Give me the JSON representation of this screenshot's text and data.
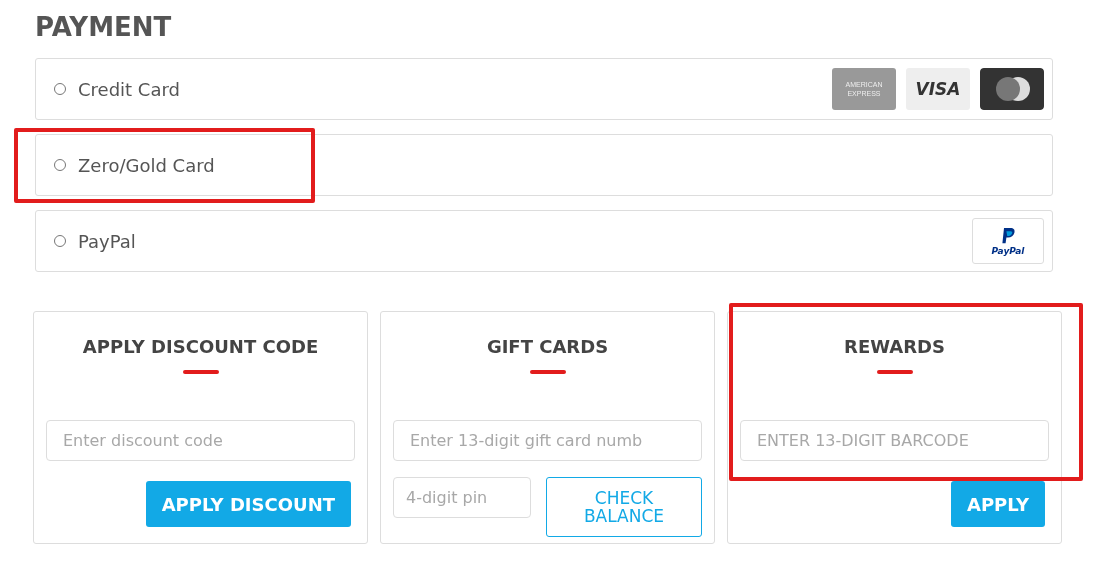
{
  "title": "PAYMENT",
  "payment_options": [
    {
      "label": "Credit Card",
      "selected": false,
      "highlighted": false,
      "logos": [
        {
          "kind": "amex",
          "text": [
            "AMERICAN",
            "EXPRESS"
          ]
        },
        {
          "kind": "visa",
          "text": [
            "VISA"
          ]
        },
        {
          "kind": "mastercard"
        }
      ]
    },
    {
      "label": "Zero/Gold Card",
      "selected": false,
      "highlighted": true
    },
    {
      "label": "PayPal",
      "selected": false,
      "highlighted": false,
      "logos": [
        {
          "kind": "paypal",
          "text": [
            "PayPal"
          ]
        }
      ]
    }
  ],
  "panels": [
    {
      "kind": "discount",
      "title": "APPLY DISCOUNT CODE",
      "highlighted": false,
      "placeholder": "Enter discount code",
      "button": "APPLY DISCOUNT"
    },
    {
      "kind": "gift",
      "title": "GIFT CARDS",
      "highlighted": false,
      "placeholder": "Enter 13-digit gift card numb",
      "pin_placeholder": "4-digit pin",
      "button": "CHECK BALANCE"
    },
    {
      "kind": "rewards",
      "title": "REWARDS",
      "highlighted": true,
      "placeholder": "ENTER 13-DIGIT BARCODE",
      "button": "APPLY"
    }
  ]
}
